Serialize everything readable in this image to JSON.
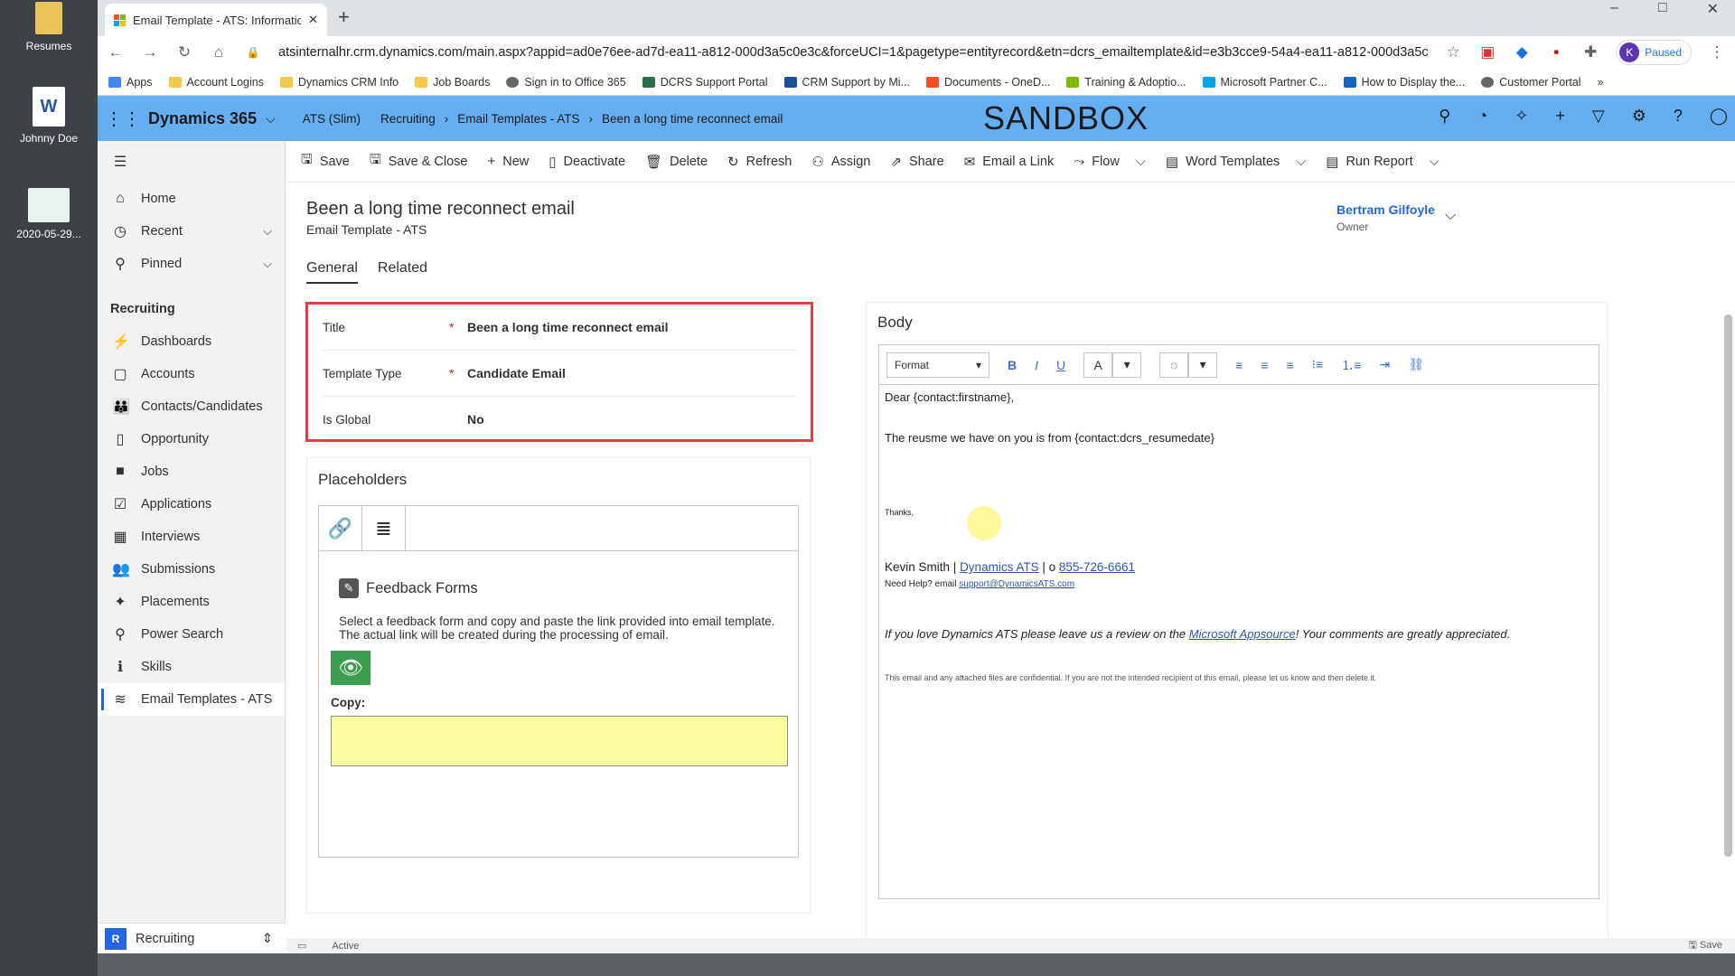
{
  "desktop": {
    "icons": [
      {
        "label": "Resumes"
      },
      {
        "label": "Johnny Doe"
      },
      {
        "label": "2020-05-29..."
      }
    ]
  },
  "browser": {
    "tab_title": "Email Template - ATS: Informatio",
    "url": "atsinternalhr.crm.dynamics.com/main.aspx?appid=ad0e76ee-ad7d-ea11-a812-000d3a5c0e3c&forceUCI=1&pagetype=entityrecord&etn=dcrs_emailtemplate&id=e3b3cce9-54a4-ea11-a812-000d3a5c0e3c",
    "profile_initial": "K",
    "profile_status": "Paused",
    "bookmarks": [
      "Apps",
      "Account Logins",
      "Dynamics CRM Info",
      "Job Boards",
      "Sign in to Office 365",
      "DCRS Support Portal",
      "CRM Support by Mi...",
      "Documents - OneD...",
      "Training & Adoptio...",
      "Microsoft Partner C...",
      "How to Display the...",
      "Customer Portal"
    ]
  },
  "header": {
    "app": "Dynamics 365",
    "breadcrumbs": [
      "ATS (Slim)",
      "Recruiting",
      "Email Templates - ATS",
      "Been a long time reconnect email"
    ],
    "env": "SANDBOX"
  },
  "sidebar": {
    "top": [
      "Home",
      "Recent",
      "Pinned"
    ],
    "group": "Recruiting",
    "items": [
      "Dashboards",
      "Accounts",
      "Contacts/Candidates",
      "Opportunity",
      "Jobs",
      "Applications",
      "Interviews",
      "Submissions",
      "Placements",
      "Power Search",
      "Skills",
      "Email Templates - ATS"
    ],
    "area": "Recruiting",
    "area_badge": "R"
  },
  "commands": [
    "Save",
    "Save & Close",
    "New",
    "Deactivate",
    "Delete",
    "Refresh",
    "Assign",
    "Share",
    "Email a Link",
    "Flow",
    "Word Templates",
    "Run Report"
  ],
  "record": {
    "title": "Been a long time reconnect email",
    "entity": "Email Template - ATS",
    "owner": "Bertram Gilfoyle",
    "owner_label": "Owner"
  },
  "tabs": [
    "General",
    "Related"
  ],
  "fields": [
    {
      "label": "Title",
      "value": "Been a long time reconnect email",
      "required": true
    },
    {
      "label": "Template Type",
      "value": "Candidate Email",
      "required": true
    },
    {
      "label": "Is Global",
      "value": "No",
      "required": false
    }
  ],
  "placeholders": {
    "title": "Placeholders",
    "ff_title": "Feedback Forms",
    "ff_desc": "Select a feedback form and copy and paste the link provided into email template. The actual link will be created during the processing of email.",
    "copy_label": "Copy:"
  },
  "body": {
    "title": "Body",
    "format_label": "Format",
    "line1": "Dear {contact:firstname},",
    "line2": "The reusme we have on you is from {contact:dcrs_resumedate}",
    "thanks": "Thanks,",
    "sig_name": "Kevin Smith |",
    "sig_link": "Dynamics ATS",
    "sig_sep": "| o",
    "sig_phone": "855-726-6661",
    "help_text": "Need Help? email",
    "help_email": "support@DynamicsATS.com",
    "review_pre": "If you love Dynamics ATS please leave us a review on the",
    "review_link": "Microsoft Appsource",
    "review_post": "!  Your comments are greatly appreciated.",
    "confidential": "This email and any attached files are confidential. If you are not the intended recipient of this email, please let us know and then delete it."
  },
  "status": {
    "state": "Active",
    "save": "Save"
  }
}
